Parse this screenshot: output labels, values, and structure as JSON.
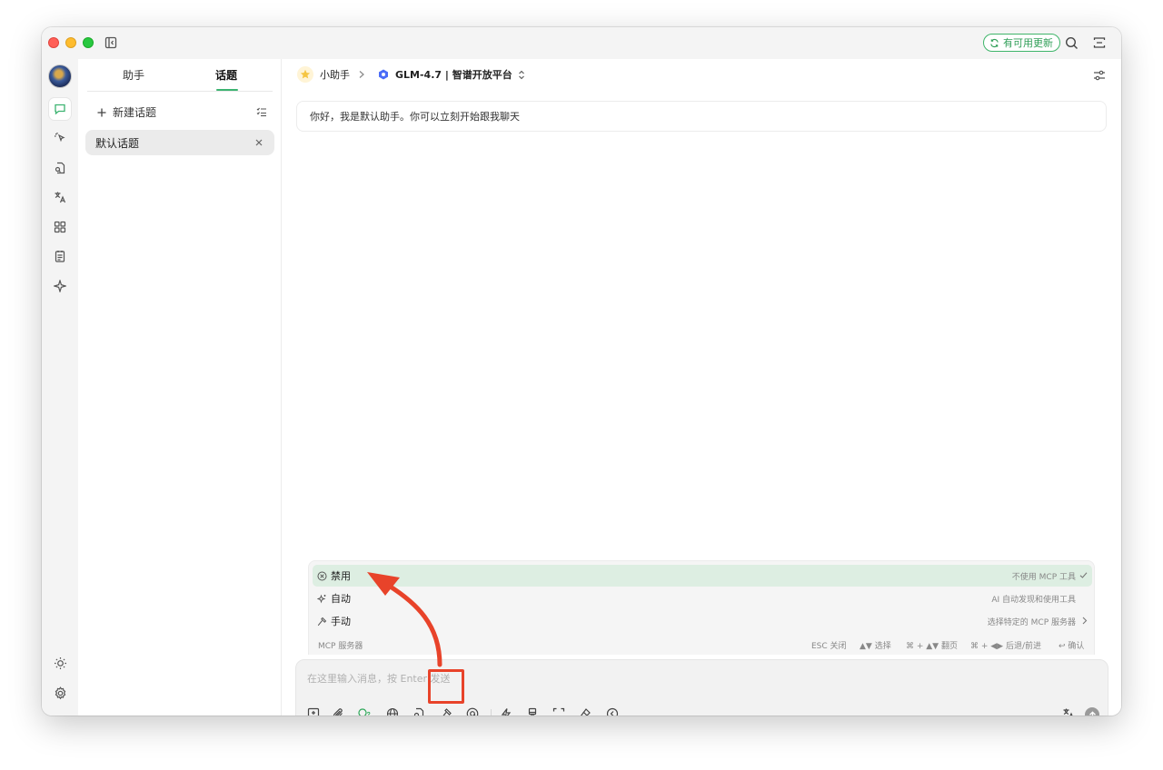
{
  "titlebar": {
    "update_label": "有可用更新"
  },
  "sidebar": {
    "tabs": [
      {
        "label": "助手"
      },
      {
        "label": "话题"
      }
    ],
    "new_topic_label": "新建话题",
    "topics": [
      {
        "label": "默认话题"
      }
    ]
  },
  "main": {
    "assistant_name": "小助手",
    "model_label": "GLM-4.7 | 智谱开放平台",
    "greeting": "你好，我是默认助手。你可以立刻开始跟我聊天"
  },
  "mcp_dropdown": {
    "options": [
      {
        "label": "禁用",
        "desc": "不使用 MCP 工具",
        "selected": true,
        "icon": "circle-x-icon"
      },
      {
        "label": "自动",
        "desc": "AI 自动发现和使用工具",
        "selected": false,
        "icon": "sparkle-icon"
      },
      {
        "label": "手动",
        "desc": "选择特定的 MCP 服务器",
        "selected": false,
        "icon": "hammer-icon"
      }
    ],
    "footer": {
      "title": "MCP 服务器",
      "hints": [
        "ESC 关闭",
        "▲▼ 选择",
        "⌘ + ▲▼ 翻页",
        "⌘ + ◀▶ 后退/前进",
        "↩ 确认"
      ]
    }
  },
  "composer": {
    "placeholder": "在这里输入消息，按 Enter 发送"
  },
  "colors": {
    "accent": "#3cb371",
    "selected_row": "#ddeee2",
    "annotation": "#e8432a"
  }
}
